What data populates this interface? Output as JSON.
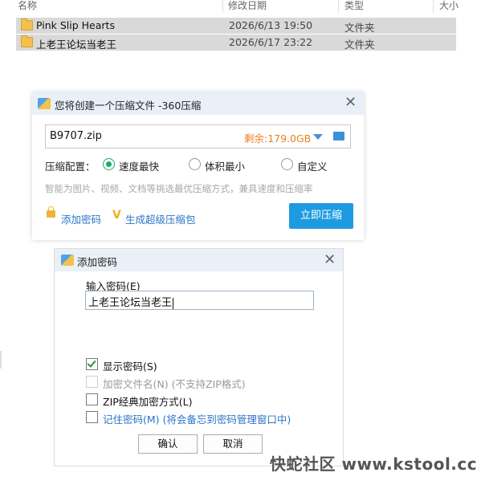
{
  "explorer": {
    "columns": {
      "name": "名称",
      "date": "修改日期",
      "type": "类型",
      "size": "大小"
    },
    "rows": [
      {
        "name": "Pink Slip Hearts",
        "date": "2026/6/13 19:50",
        "type": "文件夹"
      },
      {
        "name": "上老王论坛当老王",
        "date": "2026/6/17 23:22",
        "type": "文件夹"
      }
    ]
  },
  "compress_dialog": {
    "title": "您将创建一个压缩文件 -360压缩",
    "filename": "B9707.zip",
    "free_space": "剩余:179.0GB",
    "config_label": "压缩配置：",
    "options": [
      "速度最快",
      "体积最小",
      "自定义"
    ],
    "selected_option": "速度最快",
    "hint": "智能为图片、视频、文档等挑选最优压缩方式，兼具速度和压缩率",
    "add_password": "添加密码",
    "super_pack": "生成超级压缩包",
    "compress_now": "立即压缩"
  },
  "password_dialog": {
    "title": "添加密码",
    "input_label": "输入密码(E)",
    "password_value": "上老王论坛当老王",
    "show_password": "显示密码(S)",
    "encrypt_filenames": "加密文件名(N) (不支持ZIP格式)",
    "zip_classic": "ZIP经典加密方式(L)",
    "remember_password": "记住密码(M) (将会备忘到密码管理窗口中)",
    "ok": "确认",
    "cancel": "取消"
  },
  "watermark": "快蛇社区 www.kstool.cc",
  "colors": {
    "accent": "#1e9be0",
    "free_space": "#e8821e",
    "link": "#2b74c7",
    "radio_on": "#21a86a"
  }
}
